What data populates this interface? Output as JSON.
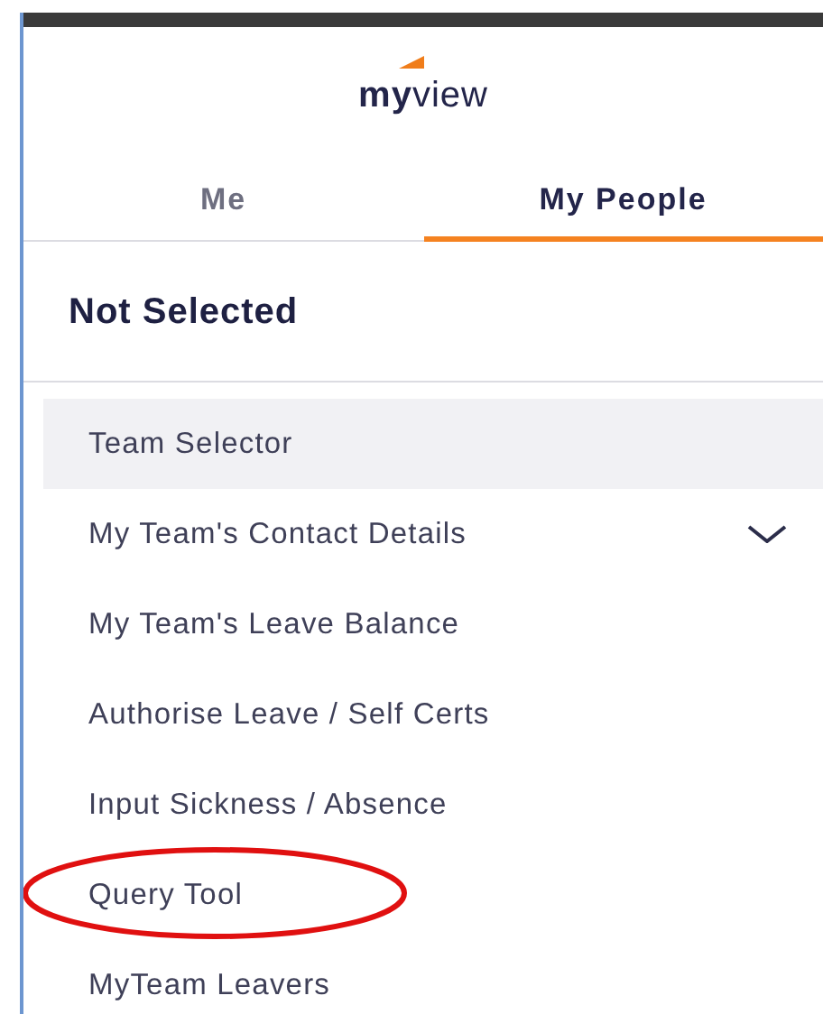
{
  "logo": {
    "text": "**my**view"
  },
  "tabs": [
    {
      "label": "Me",
      "selected": false
    },
    {
      "label": "My People",
      "selected": true
    }
  ],
  "heading": "Not Selected",
  "menu": [
    {
      "label": "Team Selector",
      "selected": true,
      "expandable": false,
      "circled": false
    },
    {
      "label": "My Team's Contact Details",
      "selected": false,
      "expandable": true,
      "circled": false
    },
    {
      "label": "My Team's Leave Balance",
      "selected": false,
      "expandable": false,
      "circled": false
    },
    {
      "label": "Authorise Leave / Self Certs",
      "selected": false,
      "expandable": false,
      "circled": false
    },
    {
      "label": "Input Sickness / Absence",
      "selected": false,
      "expandable": false,
      "circled": false
    },
    {
      "label": "Query Tool",
      "selected": false,
      "expandable": false,
      "circled": true
    },
    {
      "label": "MyTeam Leavers",
      "selected": false,
      "expandable": false,
      "circled": false
    }
  ]
}
